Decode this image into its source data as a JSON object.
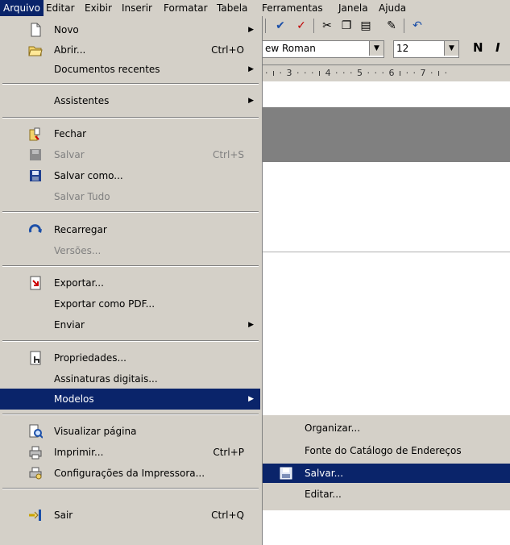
{
  "menubar": {
    "items": [
      {
        "label": "Arquivo"
      },
      {
        "label": "Editar"
      },
      {
        "label": "Exibir"
      },
      {
        "label": "Inserir"
      },
      {
        "label": "Formatar"
      },
      {
        "label": "Tabela"
      },
      {
        "label": "Ferramentas"
      },
      {
        "label": "Janela"
      },
      {
        "label": "Ajuda"
      }
    ]
  },
  "toolbar": {
    "font_name": "ew Roman",
    "font_size": "12",
    "bold_label": "N",
    "italic_label": "I",
    "ruler_text": "· ı · 3 · · · ı 4 · · · 5 · · · 6 ı · · 7 · ı ·"
  },
  "menu": {
    "items": [
      {
        "label": "Novo",
        "arrow": "▶"
      },
      {
        "label": "Abrir...",
        "shortcut": "Ctrl+O"
      },
      {
        "label": "Documentos recentes",
        "arrow": "▶"
      },
      {
        "label": "Assistentes",
        "arrow": "▶"
      },
      {
        "label": "Fechar"
      },
      {
        "label": "Salvar",
        "shortcut": "Ctrl+S"
      },
      {
        "label": "Salvar como..."
      },
      {
        "label": "Salvar Tudo"
      },
      {
        "label": "Recarregar"
      },
      {
        "label": "Versões..."
      },
      {
        "label": "Exportar..."
      },
      {
        "label": "Exportar como PDF..."
      },
      {
        "label": "Enviar",
        "arrow": "▶"
      },
      {
        "label": "Propriedades..."
      },
      {
        "label": "Assinaturas digitais..."
      },
      {
        "label": "Modelos",
        "arrow": "▶"
      },
      {
        "label": "Visualizar página"
      },
      {
        "label": "Imprimir...",
        "shortcut": "Ctrl+P"
      },
      {
        "label": "Configurações da Impressora..."
      },
      {
        "label": "Sair",
        "shortcut": "Ctrl+Q"
      }
    ]
  },
  "submenu": {
    "items": [
      {
        "label": "Organizar..."
      },
      {
        "label": "Fonte do Catálogo de Endereços"
      },
      {
        "label": "Salvar..."
      },
      {
        "label": "Editar..."
      }
    ]
  },
  "colors": {
    "menu_bg": "#d4d0c8",
    "highlight": "#0a246a",
    "disabled_text": "#808080"
  }
}
